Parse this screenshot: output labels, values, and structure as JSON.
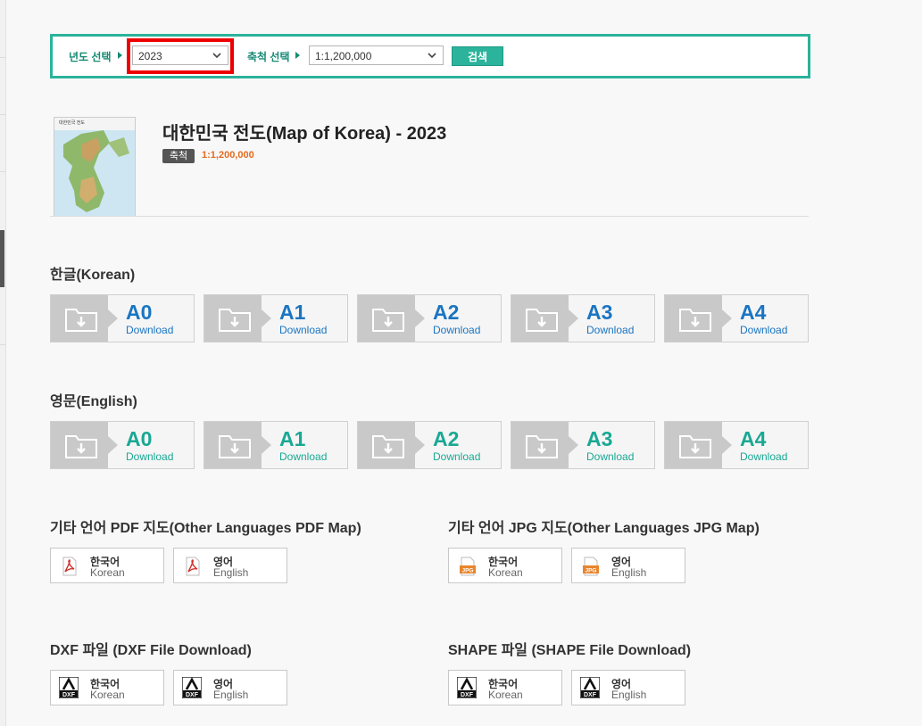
{
  "search": {
    "year_label": "년도 선택",
    "year_value": "2023",
    "scale_label": "축척 선택",
    "scale_value": "1:1,200,000",
    "search_button": "검색"
  },
  "map": {
    "thumbnail_caption": "대한민국 전도",
    "title": "대한민국 전도(Map of Korea) - 2023",
    "scale_badge": "축척",
    "scale_value": "1:1,200,000"
  },
  "sections": {
    "korean": {
      "title": "한글(Korean)",
      "tiles": [
        {
          "size": "A0",
          "label": "Download"
        },
        {
          "size": "A1",
          "label": "Download"
        },
        {
          "size": "A2",
          "label": "Download"
        },
        {
          "size": "A3",
          "label": "Download"
        },
        {
          "size": "A4",
          "label": "Download"
        }
      ]
    },
    "english": {
      "title": "영문(English)",
      "tiles": [
        {
          "size": "A0",
          "label": "Download"
        },
        {
          "size": "A1",
          "label": "Download"
        },
        {
          "size": "A2",
          "label": "Download"
        },
        {
          "size": "A3",
          "label": "Download"
        },
        {
          "size": "A4",
          "label": "Download"
        }
      ]
    },
    "pdf": {
      "title": "기타 언어 PDF 지도(Other Languages PDF Map)",
      "buttons": [
        {
          "ko": "한국어",
          "en": "Korean",
          "icon": "pdf-icon"
        },
        {
          "ko": "영어",
          "en": "English",
          "icon": "pdf-icon"
        }
      ]
    },
    "jpg": {
      "title": "기타 언어 JPG 지도(Other Languages JPG Map)",
      "buttons": [
        {
          "ko": "한국어",
          "en": "Korean",
          "icon": "jpg-icon"
        },
        {
          "ko": "영어",
          "en": "English",
          "icon": "jpg-icon"
        }
      ]
    },
    "dxf": {
      "title": "DXF 파일 (DXF File Download)",
      "buttons": [
        {
          "ko": "한국어",
          "en": "Korean",
          "icon": "dxf-icon"
        },
        {
          "ko": "영어",
          "en": "English",
          "icon": "dxf-icon"
        }
      ]
    },
    "shape": {
      "title": "SHAPE 파일 (SHAPE File Download)",
      "buttons": [
        {
          "ko": "한국어",
          "en": "Korean",
          "icon": "dxf-icon"
        },
        {
          "ko": "영어",
          "en": "English",
          "icon": "dxf-icon"
        }
      ]
    }
  },
  "icon_labels": {
    "jpg": "JPG",
    "dxf": "DXF"
  },
  "colors": {
    "accent": "#2bb39b",
    "korean_tile": "#1a75c2",
    "english_tile": "#1aa894",
    "scale_orange": "#e56a1e",
    "highlight": "#ee0000"
  }
}
